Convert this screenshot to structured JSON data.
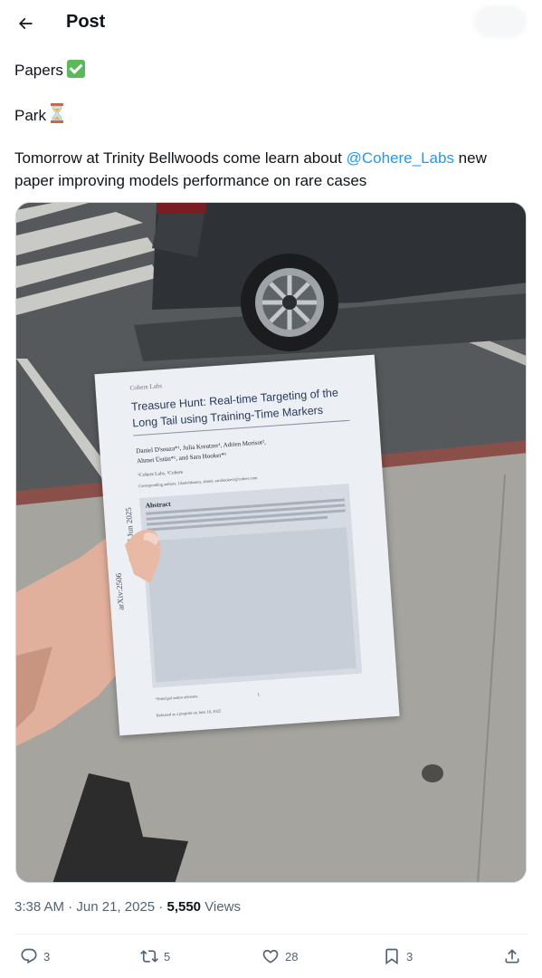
{
  "header": {
    "title": "Post",
    "back_icon": "arrow-left-icon"
  },
  "post": {
    "line1": {
      "text": "Papers",
      "emoji": "check-mark-emoji"
    },
    "line2": {
      "text": "Park",
      "emoji": "hourglass-emoji"
    },
    "body_before": "Tomorrow at Trinity Bellwoods come learn about ",
    "mention": "@Cohere_Labs",
    "body_after": " new paper improving models performance on rare cases",
    "colors": {
      "mention": "#1d9bf0",
      "text": "#0f1419",
      "muted": "#536471"
    }
  },
  "paper": {
    "org": "Cohere Labs",
    "title_line1": "Treasure Hunt: Real-time Targeting of the",
    "title_line2": "Long Tail using Training-Time Markers",
    "authors_line1": "Daniel D'souza*¹, Julia Kreutzer¹, Adrien Morisot²,",
    "authors_line2": "Ahmet Üstün*¹, and Sara Hooker*¹",
    "affiliations": "¹Cohere Labs, ²Cohere",
    "corresponding": "Corresponding authors: {danieldsouza, ahmet, sarahooker}@cohere.com",
    "abstract_heading": "Abstract",
    "arxiv_side": "arXiv:2506",
    "side_date": "CL] 17 Jun 2025",
    "footnote": "*Principal senior advisors.",
    "release": "Released as a preprint on June 18, 2025",
    "page_number": "1"
  },
  "meta": {
    "time": "3:38 AM",
    "sep1": " · ",
    "date": "Jun 21, 2025",
    "sep2": " · ",
    "views_count": "5,550",
    "views_label": " Views"
  },
  "actions": {
    "replies": "3",
    "reposts": "5",
    "likes": "28",
    "bookmarks": "3"
  }
}
